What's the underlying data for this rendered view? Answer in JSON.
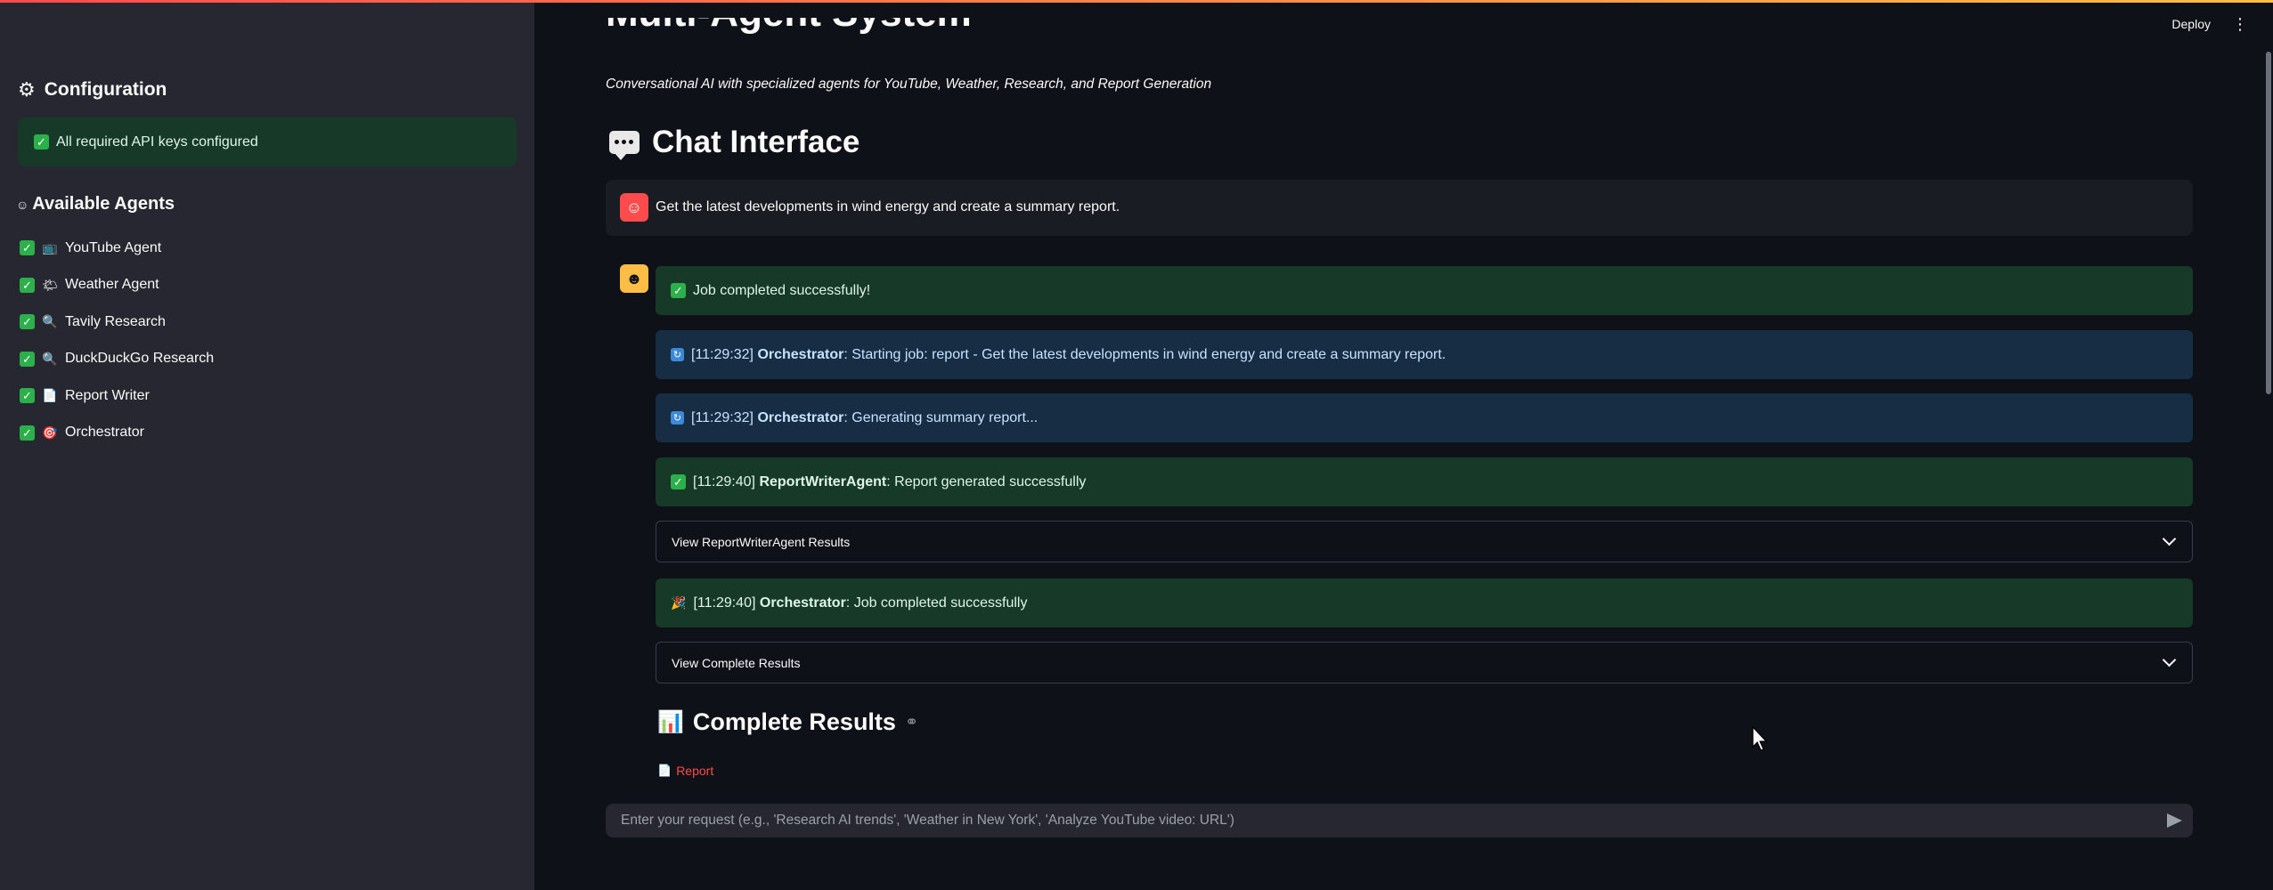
{
  "sidebar": {
    "config_title": "Configuration",
    "status_text": "All required API keys configured",
    "agents_title": "Available Agents",
    "agents": [
      {
        "emoji": "📺",
        "label": "YouTube Agent"
      },
      {
        "emoji": "🌤",
        "label": "Weather Agent"
      },
      {
        "emoji": "🔍",
        "label": "Tavily Research"
      },
      {
        "emoji": "🔍",
        "label": "DuckDuckGo Research"
      },
      {
        "emoji": "📄",
        "label": "Report Writer"
      },
      {
        "emoji": "🎯",
        "label": "Orchestrator"
      }
    ]
  },
  "header": {
    "deploy_label": "Deploy",
    "menu_glyph": "⋮"
  },
  "main": {
    "page_title_cropped": "Multi-Agent System",
    "subtitle": "Conversational AI with specialized agents for YouTube, Weather, Research, and Report Generation",
    "chat_title": "Chat Interface",
    "user_message": "Get the latest developments in wind energy and create a summary report.",
    "job_status": "Job completed successfully!",
    "log": [
      {
        "time": "[11:29:32]",
        "agent": "Orchestrator",
        "text": ": Starting job: report - Get the latest developments in wind energy and create a summary report."
      },
      {
        "time": "[11:29:32]",
        "agent": "Orchestrator",
        "text": ": Generating summary report..."
      },
      {
        "time": "[11:29:40]",
        "agent": "ReportWriterAgent",
        "text": ": Report generated successfully"
      },
      {
        "time": "[11:29:40]",
        "agent": "Orchestrator",
        "text": ": Job completed successfully"
      }
    ],
    "expander_report": "View ReportWriterAgent Results",
    "expander_complete": "View Complete Results",
    "results_title": "Complete Results",
    "report_link": "Report",
    "input_placeholder": "Enter your request (e.g., 'Research AI trends', 'Weather in New York', 'Analyze YouTube video: URL')"
  },
  "colors": {
    "background": "#0e1117",
    "sidebar": "#262730",
    "success": "#173928",
    "info": "#172d43",
    "accent": "#ff4b4b"
  }
}
